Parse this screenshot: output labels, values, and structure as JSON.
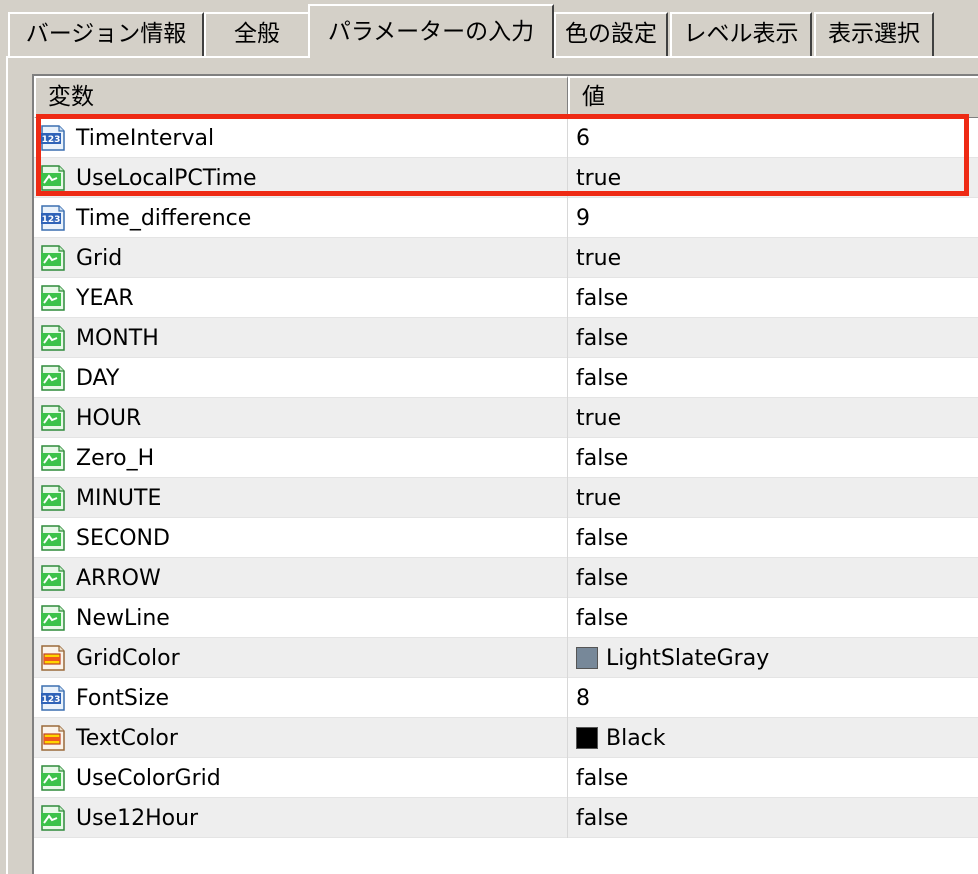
{
  "tabs": [
    {
      "label": "バージョン情報",
      "active": false
    },
    {
      "label": "全般",
      "active": false
    },
    {
      "label": "パラメーターの入力",
      "active": true
    },
    {
      "label": "色の設定",
      "active": false
    },
    {
      "label": "レベル表示",
      "active": false
    },
    {
      "label": "表示選択",
      "active": false
    }
  ],
  "table": {
    "columns": {
      "name": "変数",
      "value": "値"
    },
    "rows": [
      {
        "icon": "int-icon",
        "name": "TimeInterval",
        "value": "6"
      },
      {
        "icon": "bool-icon",
        "name": "UseLocalPCTime",
        "value": "true"
      },
      {
        "icon": "int-icon",
        "name": "Time_difference",
        "value": "9"
      },
      {
        "icon": "bool-icon",
        "name": "Grid",
        "value": "true"
      },
      {
        "icon": "bool-icon",
        "name": "YEAR",
        "value": "false"
      },
      {
        "icon": "bool-icon",
        "name": "MONTH",
        "value": "false"
      },
      {
        "icon": "bool-icon",
        "name": "DAY",
        "value": "false"
      },
      {
        "icon": "bool-icon",
        "name": "HOUR",
        "value": "true"
      },
      {
        "icon": "bool-icon",
        "name": "Zero_H",
        "value": "false"
      },
      {
        "icon": "bool-icon",
        "name": "MINUTE",
        "value": "true"
      },
      {
        "icon": "bool-icon",
        "name": "SECOND",
        "value": "false"
      },
      {
        "icon": "bool-icon",
        "name": "ARROW",
        "value": "false"
      },
      {
        "icon": "bool-icon",
        "name": "NewLine",
        "value": "false"
      },
      {
        "icon": "color-icon",
        "name": "GridColor",
        "value": "LightSlateGray",
        "swatch": "#778899"
      },
      {
        "icon": "int-icon",
        "name": "FontSize",
        "value": "8"
      },
      {
        "icon": "color-icon",
        "name": "TextColor",
        "value": "Black",
        "swatch": "#000000"
      },
      {
        "icon": "bool-icon",
        "name": "UseColorGrid",
        "value": "false"
      },
      {
        "icon": "bool-icon",
        "name": "Use12Hour",
        "value": "false"
      }
    ]
  },
  "highlight_color": "#ee2a14"
}
